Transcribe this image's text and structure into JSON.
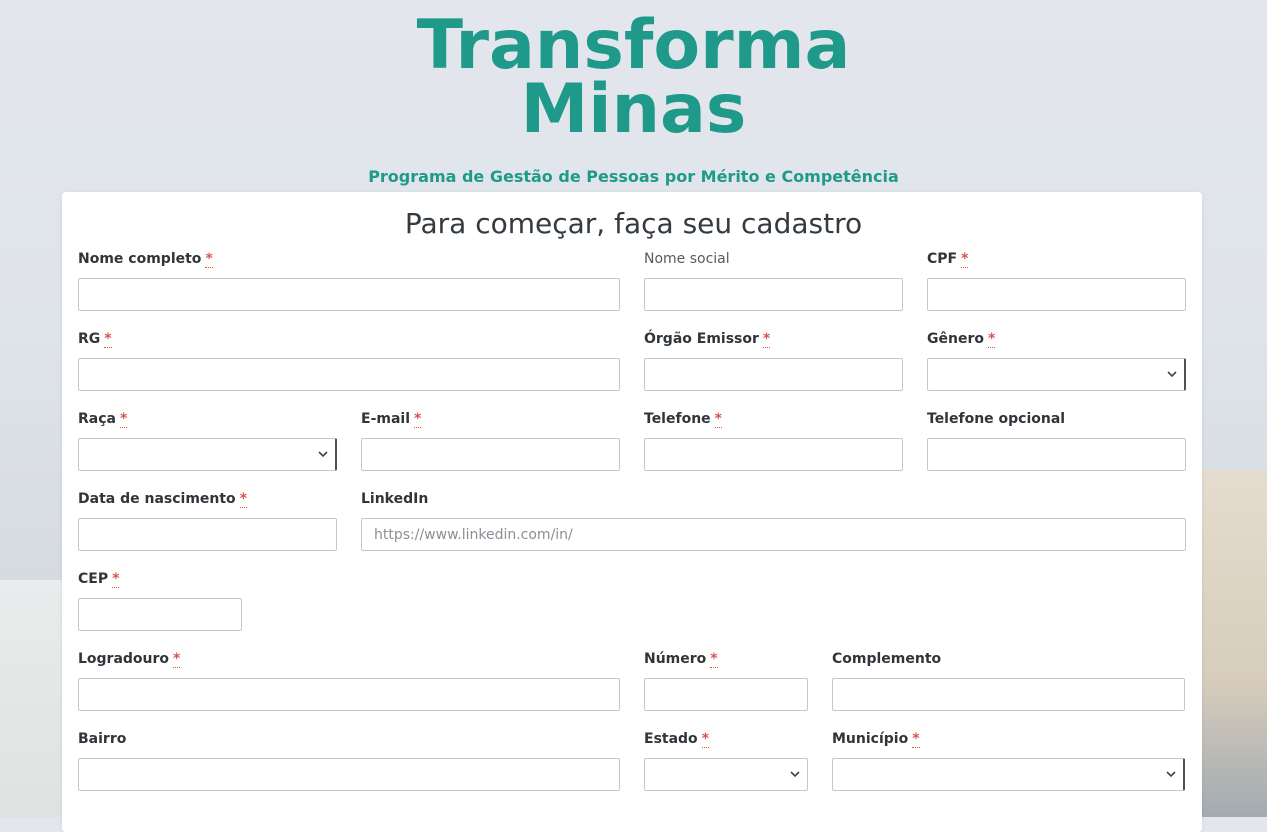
{
  "brand": {
    "line1": "Transforma",
    "line2": "Minas",
    "tagline": "Programa de Gestão de Pessoas por Mérito e Competência",
    "color": "#1f9a8a"
  },
  "form": {
    "title": "Para começar, faça seu cadastro",
    "required_mark": "*",
    "fields": {
      "nome_completo": {
        "label": "Nome completo",
        "value": ""
      },
      "nome_social": {
        "label": "Nome social",
        "value": ""
      },
      "cpf": {
        "label": "CPF",
        "value": ""
      },
      "rg": {
        "label": "RG",
        "value": ""
      },
      "orgao_emissor": {
        "label": "Órgão Emissor",
        "value": ""
      },
      "genero": {
        "label": "Gênero",
        "value": ""
      },
      "raca": {
        "label": "Raça",
        "value": ""
      },
      "email": {
        "label": "E-mail",
        "value": ""
      },
      "telefone": {
        "label": "Telefone",
        "value": ""
      },
      "telefone_opcional": {
        "label": "Telefone opcional",
        "value": ""
      },
      "data_nascimento": {
        "label": "Data de nascimento",
        "value": ""
      },
      "linkedin": {
        "label": "LinkedIn",
        "value": "",
        "placeholder": "https://www.linkedin.com/in/"
      },
      "cep": {
        "label": "CEP",
        "value": ""
      },
      "logradouro": {
        "label": "Logradouro",
        "value": ""
      },
      "numero": {
        "label": "Número",
        "value": ""
      },
      "complemento": {
        "label": "Complemento",
        "value": ""
      },
      "bairro": {
        "label": "Bairro",
        "value": ""
      },
      "estado": {
        "label": "Estado",
        "value": ""
      },
      "municipio": {
        "label": "Município",
        "value": ""
      }
    }
  },
  "colors": {
    "required": "#d9534f",
    "label": "#30353a"
  }
}
